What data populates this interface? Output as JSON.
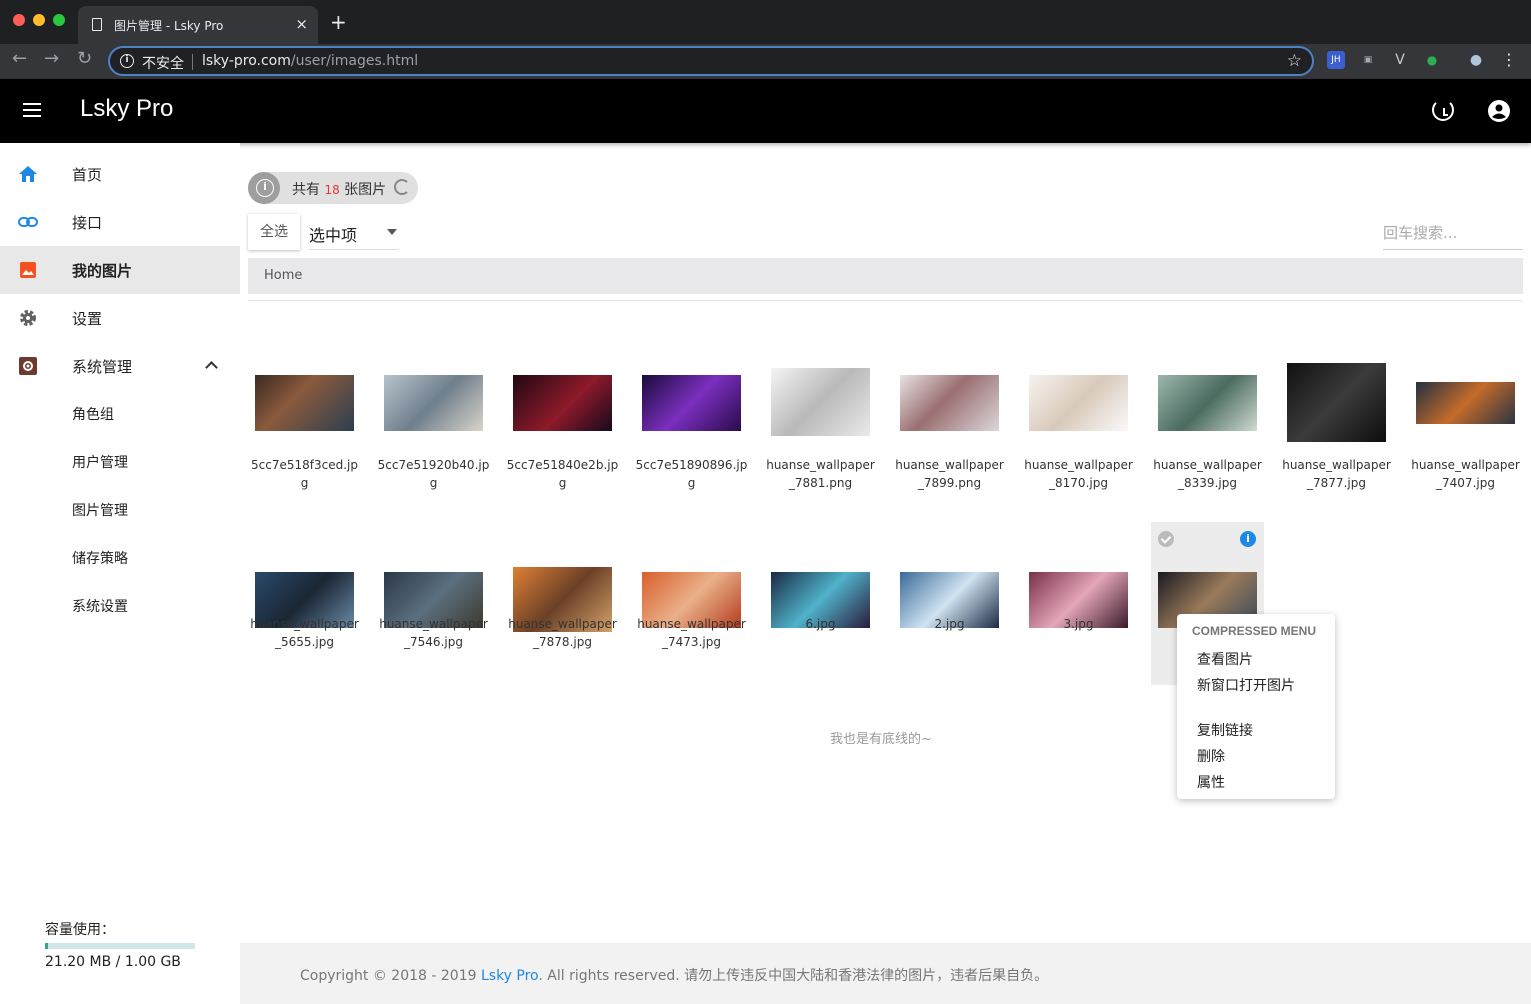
{
  "browser": {
    "tab_title": "图片管理 - Lsky Pro",
    "tab_close": "×",
    "new_tab": "+",
    "security_label": "不安全",
    "url_host": "lsky-pro.com",
    "url_path": "/user/images.html",
    "back_icon": "←",
    "forward_icon": "→",
    "reload_icon": "↻",
    "star_icon": "☆",
    "extensions": [
      "JH",
      "▣",
      "V",
      "●",
      "●",
      "⋮"
    ]
  },
  "header": {
    "brand": "Lsky Pro"
  },
  "sidebar": {
    "items": [
      {
        "label": "首页",
        "icon": "home-icon"
      },
      {
        "label": "接口",
        "icon": "link-icon"
      },
      {
        "label": "我的图片",
        "icon": "image-icon",
        "active": true
      },
      {
        "label": "设置",
        "icon": "gear-icon"
      },
      {
        "label": "系统管理",
        "icon": "admin-icon",
        "expanded": true
      }
    ],
    "sub_items": [
      "角色组",
      "用户管理",
      "图片管理",
      "储存策略",
      "系统设置"
    ],
    "quota_label": "容量使用：",
    "quota_text": "21.20 MB / 1.00 GB",
    "quota_fraction": 0.0207
  },
  "main": {
    "chip_prefix": "共有 ",
    "chip_count": "18",
    "chip_suffix": " 张图片",
    "select_all": "全选",
    "selected_action": "选中项",
    "search_placeholder": "回车搜索...",
    "breadcrumb": "Home",
    "images": [
      "5cc7e518f3ced.jpg",
      "5cc7e51920b40.jpg",
      "5cc7e51840e2b.jpg",
      "5cc7e51890896.jpg",
      "huanse_wallpaper_7881.png",
      "huanse_wallpaper_7899.png",
      "huanse_wallpaper_8170.jpg",
      "huanse_wallpaper_8339.jpg",
      "huanse_wallpaper_7877.jpg",
      "huanse_wallpaper_7407.jpg",
      "huanse_wallpaper_5655.jpg",
      "huanse_wallpaper_7546.jpg",
      "huanse_wallpaper_7878.jpg",
      "huanse_wallpaper_7473.jpg",
      "6.jpg",
      "2.jpg",
      "3.jpg",
      ""
    ],
    "bottom_note": "我也是有底线的~"
  },
  "context_menu": {
    "header": "COMPRESSED MENU",
    "items": [
      "查看图片",
      "新窗口打开图片",
      "复制链接",
      "删除",
      "属性"
    ]
  },
  "footer": {
    "prefix": "Copyright © 2018 - 2019 ",
    "link": "Lsky Pro",
    "suffix": ". All rights reserved. 请勿上传违反中国大陆和香港法律的图片，违者后果自负。"
  },
  "colors": {
    "accent": "#1e88e5",
    "count_red": "#e53935",
    "appbar": "#000000"
  }
}
